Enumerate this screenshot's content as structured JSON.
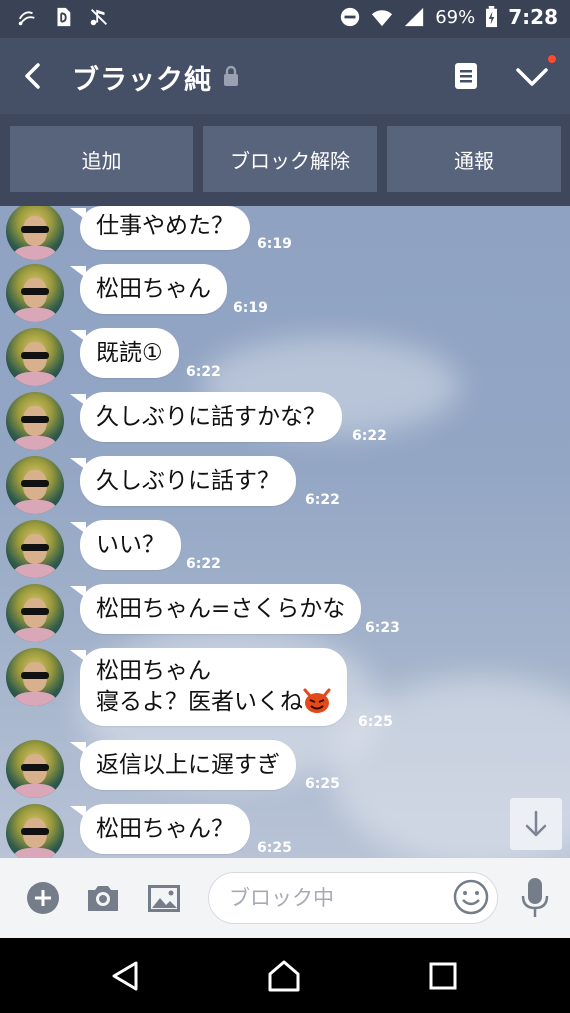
{
  "status_bar": {
    "battery": "69%",
    "time": "7:28",
    "icons": [
      "nfc-icon",
      "sim-icon",
      "silent-icon",
      "do-not-disturb-icon",
      "wifi-icon",
      "signal-icon",
      "battery-charging-icon"
    ]
  },
  "header": {
    "title": "ブラック純",
    "icons": [
      "back-arrow-icon",
      "lock-icon",
      "note-icon",
      "chevron-down-icon"
    ],
    "accent": "#ff4a2e"
  },
  "actions": [
    {
      "label": "追加"
    },
    {
      "label": "ブロック解除"
    },
    {
      "label": "通報"
    }
  ],
  "messages": [
    {
      "text": "仕事やめた？",
      "time": "6:19"
    },
    {
      "text": "松田ちゃん",
      "time": "6:19"
    },
    {
      "text": "既読①",
      "time": "6:22"
    },
    {
      "text": "久しぶりに話すかな？",
      "time": "6:22"
    },
    {
      "text": "久しぶりに話す？",
      "time": "6:22"
    },
    {
      "text": "いい？",
      "time": "6:22"
    },
    {
      "text": "松田ちゃん=さくらかな",
      "time": "6:23"
    },
    {
      "text": "松田ちゃん",
      "text2": "寝るよ？医者いくね",
      "emoji": "devil-emoji",
      "time": "6:25"
    },
    {
      "text": "返信以上に遅すぎ",
      "time": "6:25"
    },
    {
      "text": "松田ちゃん？",
      "time": "6:25"
    }
  ],
  "input": {
    "placeholder": "ブロック中",
    "icons": [
      "plus-icon",
      "camera-icon",
      "image-icon",
      "emoji-icon",
      "microphone-icon"
    ]
  },
  "nav": {
    "icons": [
      "back-triangle-icon",
      "home-icon",
      "recents-icon"
    ]
  },
  "colors": {
    "header_bg": "#454f65",
    "action_button_bg": "#58637c",
    "chat_bg": "#93a6c4"
  }
}
